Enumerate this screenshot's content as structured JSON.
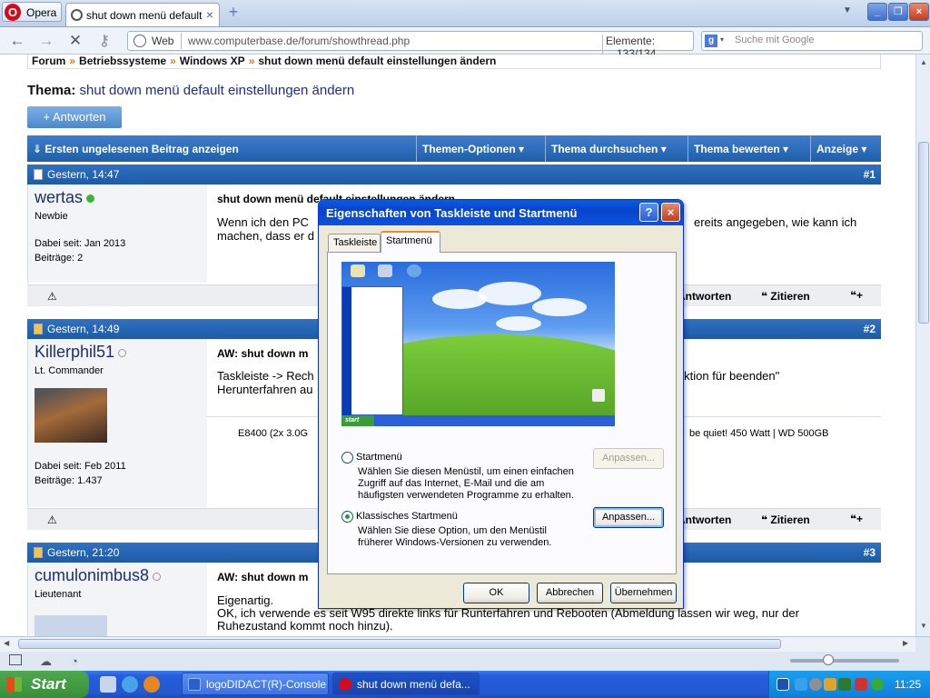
{
  "browser": {
    "menu_label": "Opera",
    "tab_title": "shut down menü default ...",
    "tab_close": "×",
    "new_tab": "+",
    "address_mode": "Web",
    "url": "www.computerbase.de/forum/showthread.php",
    "elements_label": "Elemente:",
    "elements_count": "133/134",
    "search_placeholder": "Suche mit Google"
  },
  "page": {
    "breadcrumb": [
      "Forum",
      "Betriebssysteme",
      "Windows XP",
      "shut down menü default einstellungen ändern"
    ],
    "breadcrumb_sep": "»",
    "thema_label": "Thema:",
    "thema_title": "shut down menü default einstellungen ändern",
    "reply_button": "+ Antworten",
    "first_unread": "Ersten ungelesenen Beitrag anzeigen",
    "options": [
      "Themen-Optionen",
      "Thema durchsuchen",
      "Thema bewerten",
      "Anzeige"
    ]
  },
  "posts": [
    {
      "date": "Gestern, 14:47",
      "number": "#1",
      "user": "wertas",
      "rank": "Newbie",
      "online": true,
      "joined": "Dabei seit: Jan 2013",
      "count": "Beiträge: 2",
      "title": "shut down menü default einstellungen ändern",
      "text1": "Wenn ich den PC",
      "text1b": "ereits angegeben, wie kann ich",
      "text2": "machen, dass er d"
    },
    {
      "date": "Gestern, 14:49",
      "number": "#2",
      "user": "Killerphil51",
      "rank": "Lt. Commander",
      "online": false,
      "joined": "Dabei seit: Feb 2011",
      "count": "Beiträge: 1.437",
      "title": "AW: shut down m",
      "text1": "Taskleiste -> Rech",
      "text1b": "rtaktion für beenden\"",
      "text2": "Herunterfahren au",
      "sig_a": "E8400 (2x 3.0G",
      "sig_b": "be quiet! 450 Watt | WD 500GB"
    },
    {
      "date": "Gestern, 21:20",
      "number": "#3",
      "user": "cumulonimbus8",
      "rank": "Lieutenant",
      "online": false,
      "title": "AW: shut down m",
      "text1": "Eigenartig.",
      "text2": "OK, ich verwende es seit W95 direkte links für Runterfahren und Rebooten (Abmeldung lassen wir weg, nur der",
      "text3": "Ruhezustand kommt noch hinzu)."
    }
  ],
  "actions": {
    "warn": "⚠",
    "reply": "Antworten",
    "quote": "Zitieren",
    "multi": "+"
  },
  "dialog": {
    "title": "Eigenschaften von Taskleiste und Startmenü",
    "help": "?",
    "close": "×",
    "tabs": [
      "Taskleiste",
      "Startmenü"
    ],
    "active_tab": 1,
    "preview_start": "start",
    "option1_label": "Startmenü",
    "option1_desc": [
      "Wählen Sie diesen Menüstil, um einen einfachen",
      "Zugriff auf das Internet, E-Mail und die am",
      "häufigsten verwendeten Programme zu erhalten."
    ],
    "option2_label": "Klassisches Startmenü",
    "option2_desc": [
      "Wählen Sie diese Option, um den Menüstil",
      "früherer Windows-Versionen zu verwenden."
    ],
    "customize": "Anpassen...",
    "selected": 2,
    "ok": "OK",
    "cancel": "Abbrechen",
    "apply": "Übernehmen"
  },
  "taskbar": {
    "start": "Start",
    "tasks": [
      "logoDIDACT(R)-Console",
      "shut down menü defa..."
    ],
    "clock": "11:25"
  },
  "colors": {
    "link": "#1f2f88",
    "header": "#2060aa",
    "online": "#3bb534",
    "xp_blue": "#245edb",
    "xp_green": "#3a8e3a"
  }
}
